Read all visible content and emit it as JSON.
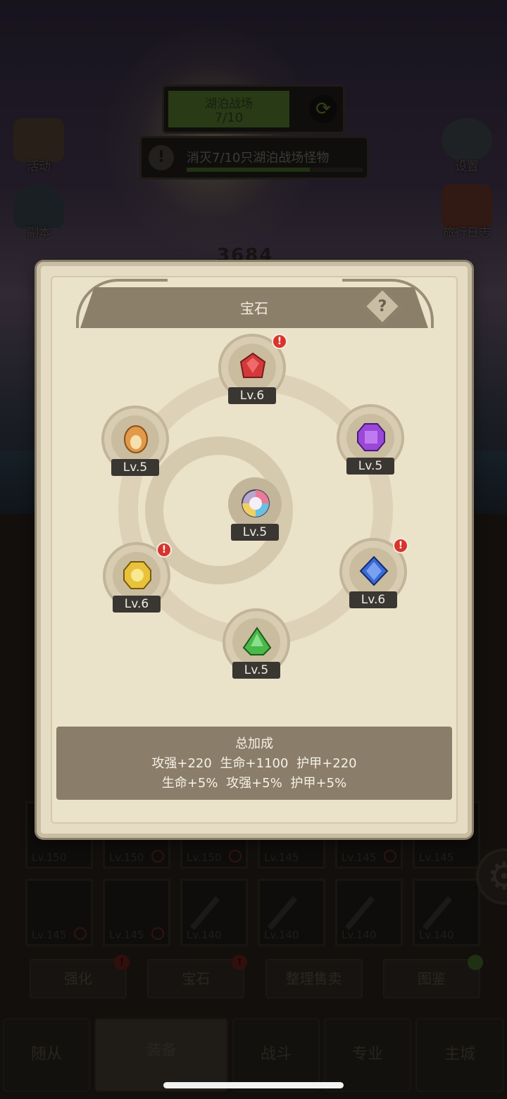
{
  "quest": {
    "title": "湖泊战场",
    "count": "7/10"
  },
  "task": {
    "text": "消灭7/10只湖泊战场怪物",
    "progress": 0.7
  },
  "side": {
    "activity": "活动",
    "dungeon": "副本",
    "settings": "设置",
    "travel_log": "旅行日志"
  },
  "score": "3684",
  "equip_rows": [
    [
      "Lv.150",
      "Lv.150",
      "Lv.150",
      "Lv.145",
      "Lv.145",
      "Lv.145"
    ],
    [
      "Lv.145",
      "Lv.145",
      "Lv.140",
      "Lv.140",
      "Lv.140",
      "Lv.140"
    ]
  ],
  "actions": {
    "strengthen": "强化",
    "gem": "宝石",
    "sort_sell": "整理售卖",
    "codex": "图鉴",
    "alert": "!"
  },
  "nav": {
    "follower": "随从",
    "equipment": "装备",
    "battle": "战斗",
    "profession": "专业",
    "main_city": "主城"
  },
  "dialog": {
    "title": "宝石",
    "help": "?",
    "gems": [
      {
        "name": "red",
        "level": "Lv.6",
        "alert": "!",
        "color": "#d23a3a"
      },
      {
        "name": "orange",
        "level": "Lv.5",
        "color": "#e09a4a"
      },
      {
        "name": "purple",
        "level": "Lv.5",
        "color": "#9a48d8"
      },
      {
        "name": "rainbow",
        "level": "Lv.5",
        "color": "#c8b8d8"
      },
      {
        "name": "yellow",
        "level": "Lv.6",
        "alert": "!",
        "color": "#e8c23a"
      },
      {
        "name": "blue",
        "level": "Lv.6",
        "alert": "!",
        "color": "#3a6ad8"
      },
      {
        "name": "green",
        "level": "Lv.5",
        "color": "#4ab84a"
      }
    ],
    "bonus": {
      "title": "总加成",
      "line1": "攻强+220  生命+1100  护甲+220",
      "line2": "生命+5%  攻强+5%  护甲+5%"
    }
  }
}
